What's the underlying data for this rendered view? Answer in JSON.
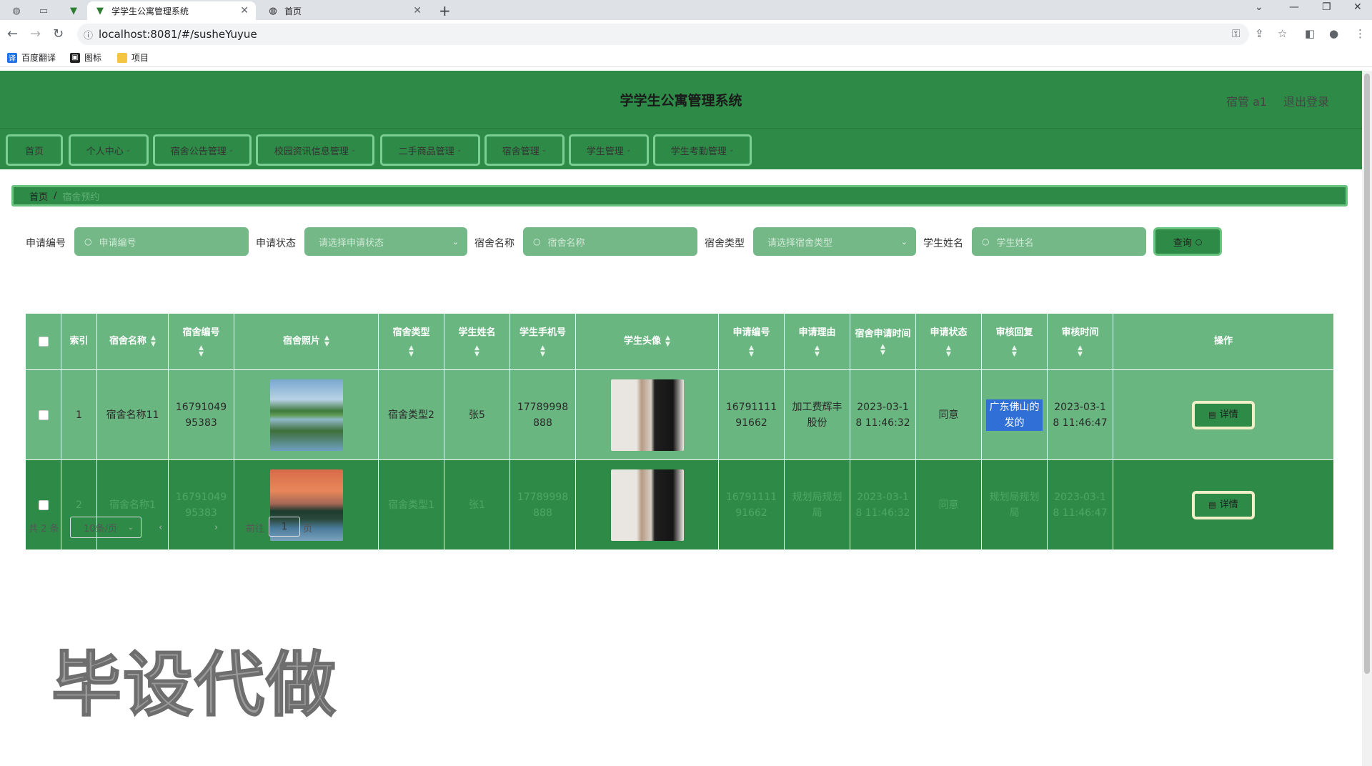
{
  "browser": {
    "tabs": [
      {
        "title": "学学生公寓管理系统",
        "icon": "vue-icon",
        "active": true
      },
      {
        "title": "首页",
        "icon": "globe-icon",
        "active": false
      }
    ],
    "url": "localhost:8081/#/susheYuyue",
    "bookmarks": [
      {
        "label": "百度翻译",
        "icon": "translate-icon",
        "color": "#1a73e8"
      },
      {
        "label": "图标",
        "icon": "icon-bookmark",
        "color": "#222222"
      },
      {
        "label": "项目",
        "icon": "folder-icon",
        "color": "#f4c542"
      }
    ]
  },
  "header": {
    "title": "学学生公寓管理系统",
    "user": "宿管 a1",
    "logout": "退出登录",
    "color": "#2e8b47"
  },
  "menu": [
    {
      "label": "首页",
      "caret": false
    },
    {
      "label": "个人中心",
      "caret": true
    },
    {
      "label": "宿舍公告管理",
      "caret": true
    },
    {
      "label": "校园资讯信息管理",
      "caret": true
    },
    {
      "label": "二手商品管理",
      "caret": true
    },
    {
      "label": "宿舍管理",
      "caret": true
    },
    {
      "label": "学生管理",
      "caret": true
    },
    {
      "label": "学生考勤管理",
      "caret": true
    }
  ],
  "breadcrumb": {
    "home": "首页",
    "sep": "/",
    "current": "宿舍预约"
  },
  "search": {
    "fields": [
      {
        "label": "申请编号",
        "placeholder": "申请编号",
        "type": "text"
      },
      {
        "label": "申请状态",
        "placeholder": "请选择申请状态",
        "type": "select"
      },
      {
        "label": "宿舍名称",
        "placeholder": "宿舍名称",
        "type": "text"
      },
      {
        "label": "宿舍类型",
        "placeholder": "请选择宿舍类型",
        "type": "select"
      },
      {
        "label": "学生姓名",
        "placeholder": "学生姓名",
        "type": "text"
      }
    ],
    "query_label": "查询"
  },
  "table": {
    "columns": [
      {
        "label": "",
        "sortable": false
      },
      {
        "label": "索引",
        "sortable": false
      },
      {
        "label": "宿舍名称",
        "sortable": true
      },
      {
        "label": "宿舍编号",
        "sortable": true
      },
      {
        "label": "宿舍照片",
        "sortable": true
      },
      {
        "label": "宿舍类型",
        "sortable": true
      },
      {
        "label": "学生姓名",
        "sortable": true
      },
      {
        "label": "学生手机号",
        "sortable": true
      },
      {
        "label": "学生头像",
        "sortable": true
      },
      {
        "label": "申请编号",
        "sortable": true
      },
      {
        "label": "申请理由",
        "sortable": true
      },
      {
        "label": "宿舍申请时间",
        "sortable": true
      },
      {
        "label": "申请状态",
        "sortable": true
      },
      {
        "label": "审核回复",
        "sortable": true
      },
      {
        "label": "审核时间",
        "sortable": true
      },
      {
        "label": "操作",
        "sortable": false
      }
    ],
    "rows": [
      {
        "index": "1",
        "name": "宿舍名称11",
        "code": "1679104995383",
        "type": "宿舍类型2",
        "student": "张5",
        "phone": "17789998888",
        "apply_no": "1679111191662",
        "reason": "加工费辉丰股份",
        "apply_time": "2023-03-18 11:46:32",
        "status": "同意",
        "reply": "广东佛山的发的",
        "review_time": "2023-03-18 11:46:47",
        "action": "详情",
        "bg": "#6ab680"
      },
      {
        "index": "2",
        "name": "宿舍名称1",
        "code": "1679104995383",
        "type": "宿舍类型1",
        "student": "张1",
        "phone": "17789998888",
        "apply_no": "1679111191662",
        "reason": "规划局规划局",
        "apply_time": "2023-03-18 11:46:32",
        "status": "同意",
        "reply": "规划局规划局",
        "review_time": "2023-03-18 11:46:47",
        "action": "详情",
        "bg": "#2e8b47"
      }
    ]
  },
  "pagination": {
    "total": "共 2 条",
    "page_size": "10条/页",
    "current": "1",
    "goto_label": "前往",
    "goto_value": "1",
    "page_suffix": "页"
  },
  "watermark": "毕设代做"
}
